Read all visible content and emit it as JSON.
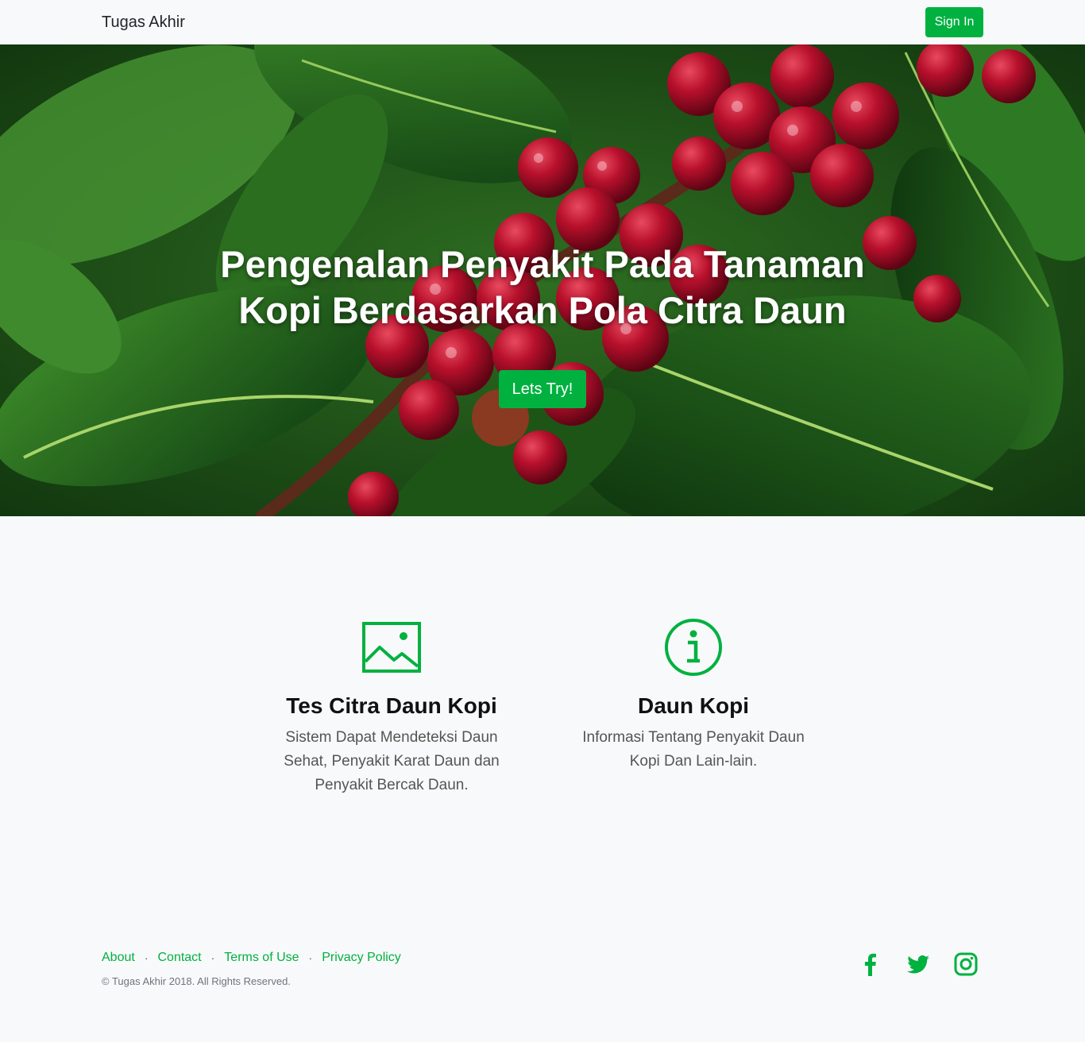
{
  "navbar": {
    "brand": "Tugas Akhir",
    "signin_label": "Sign In"
  },
  "hero": {
    "title": "Pengenalan Penyakit Pada Tanaman Kopi Berdasarkan Pola Citra Daun",
    "button_label": "Lets Try!"
  },
  "features": [
    {
      "icon": "image-icon",
      "title": "Tes Citra Daun Kopi",
      "text": "Sistem Dapat Mendeteksi Daun Sehat, Penyakit Karat Daun dan Penyakit Bercak Daun."
    },
    {
      "icon": "info-icon",
      "title": "Daun Kopi",
      "text": "Informasi Tentang Penyakit Daun Kopi Dan Lain-lain."
    }
  ],
  "footer": {
    "links": [
      "About",
      "Contact",
      "Terms of Use",
      "Privacy Policy"
    ],
    "separator": "·",
    "copyright": "© Tugas Akhir 2018. All Rights Reserved.",
    "social": [
      "facebook-icon",
      "twitter-icon",
      "instagram-icon"
    ]
  },
  "colors": {
    "accent": "#00b140",
    "background": "#f8f9fa"
  }
}
